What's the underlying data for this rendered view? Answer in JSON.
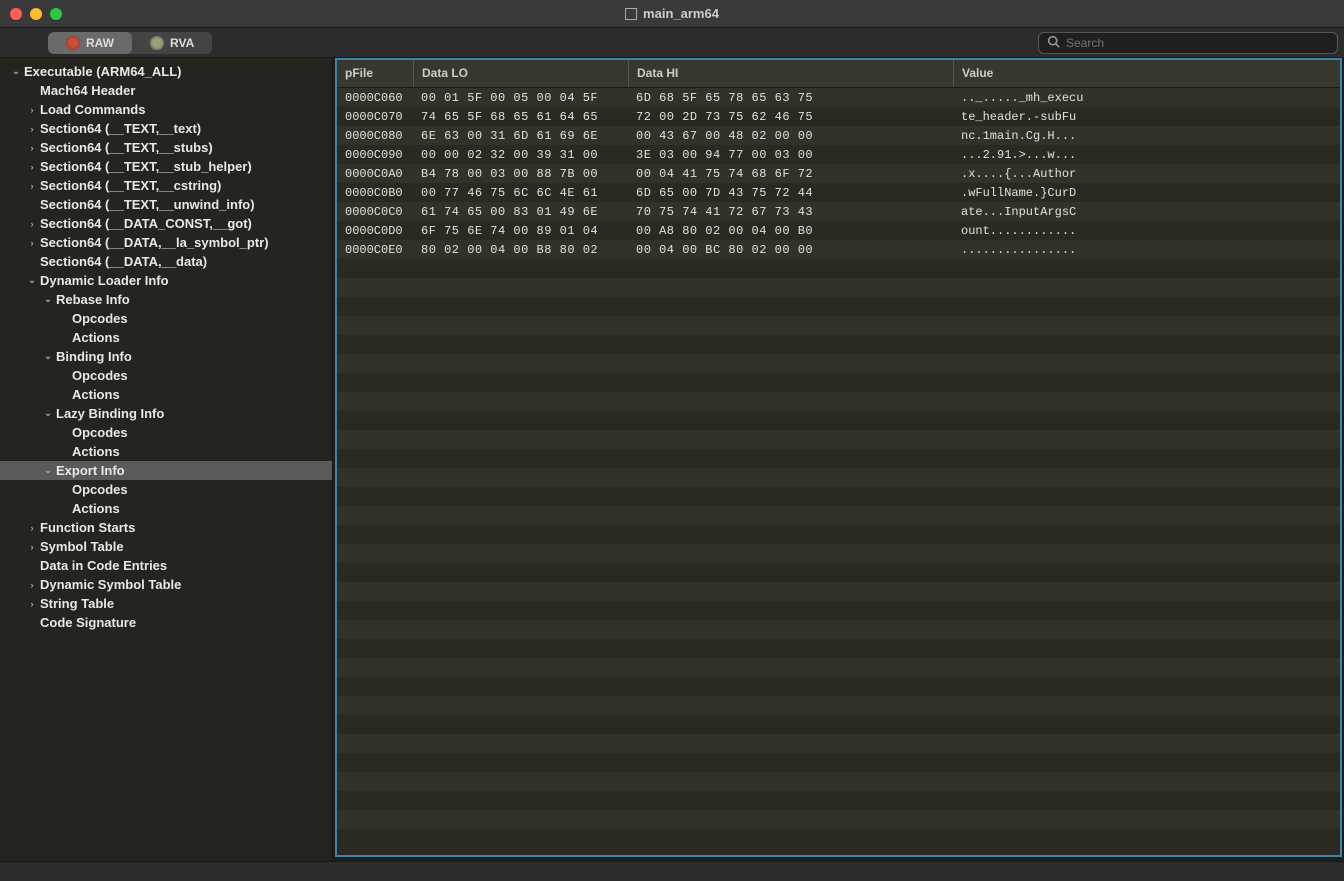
{
  "window": {
    "title": "main_arm64"
  },
  "toolbar": {
    "segments": [
      {
        "label": "RAW",
        "active": true
      },
      {
        "label": "RVA",
        "active": false
      }
    ],
    "search_placeholder": "Search"
  },
  "tree": [
    {
      "label": "Executable  (ARM64_ALL)",
      "depth": 0,
      "disclosure": "open"
    },
    {
      "label": "Mach64 Header",
      "depth": 1,
      "disclosure": "none"
    },
    {
      "label": "Load Commands",
      "depth": 1,
      "disclosure": "closed"
    },
    {
      "label": "Section64 (__TEXT,__text)",
      "depth": 1,
      "disclosure": "closed"
    },
    {
      "label": "Section64 (__TEXT,__stubs)",
      "depth": 1,
      "disclosure": "closed"
    },
    {
      "label": "Section64 (__TEXT,__stub_helper)",
      "depth": 1,
      "disclosure": "closed"
    },
    {
      "label": "Section64 (__TEXT,__cstring)",
      "depth": 1,
      "disclosure": "closed"
    },
    {
      "label": "Section64 (__TEXT,__unwind_info)",
      "depth": 1,
      "disclosure": "none"
    },
    {
      "label": "Section64 (__DATA_CONST,__got)",
      "depth": 1,
      "disclosure": "closed"
    },
    {
      "label": "Section64 (__DATA,__la_symbol_ptr)",
      "depth": 1,
      "disclosure": "closed"
    },
    {
      "label": "Section64 (__DATA,__data)",
      "depth": 1,
      "disclosure": "none"
    },
    {
      "label": "Dynamic Loader Info",
      "depth": 1,
      "disclosure": "open"
    },
    {
      "label": "Rebase Info",
      "depth": 2,
      "disclosure": "open"
    },
    {
      "label": "Opcodes",
      "depth": 3,
      "disclosure": "none"
    },
    {
      "label": "Actions",
      "depth": 3,
      "disclosure": "none"
    },
    {
      "label": "Binding Info",
      "depth": 2,
      "disclosure": "open"
    },
    {
      "label": "Opcodes",
      "depth": 3,
      "disclosure": "none"
    },
    {
      "label": "Actions",
      "depth": 3,
      "disclosure": "none"
    },
    {
      "label": "Lazy Binding Info",
      "depth": 2,
      "disclosure": "open"
    },
    {
      "label": "Opcodes",
      "depth": 3,
      "disclosure": "none"
    },
    {
      "label": "Actions",
      "depth": 3,
      "disclosure": "none"
    },
    {
      "label": "Export Info",
      "depth": 2,
      "disclosure": "open",
      "selected": true
    },
    {
      "label": "Opcodes",
      "depth": 3,
      "disclosure": "none"
    },
    {
      "label": "Actions",
      "depth": 3,
      "disclosure": "none"
    },
    {
      "label": "Function Starts",
      "depth": 1,
      "disclosure": "closed"
    },
    {
      "label": "Symbol Table",
      "depth": 1,
      "disclosure": "closed"
    },
    {
      "label": "Data in Code Entries",
      "depth": 1,
      "disclosure": "none"
    },
    {
      "label": "Dynamic Symbol Table",
      "depth": 1,
      "disclosure": "closed"
    },
    {
      "label": "String Table",
      "depth": 1,
      "disclosure": "closed"
    },
    {
      "label": "Code Signature",
      "depth": 1,
      "disclosure": "none"
    }
  ],
  "columns": {
    "pfile": "pFile",
    "data_lo": "Data LO",
    "data_hi": "Data HI",
    "value": "Value"
  },
  "rows": [
    {
      "pfile": "0000C060",
      "lo": "00 01 5F 00 05 00 04 5F",
      "hi": "6D 68 5F 65 78 65 63 75",
      "val": ".._....._mh_execu"
    },
    {
      "pfile": "0000C070",
      "lo": "74 65 5F 68 65 61 64 65",
      "hi": "72 00 2D 73 75 62 46 75",
      "val": "te_header.-subFu"
    },
    {
      "pfile": "0000C080",
      "lo": "6E 63 00 31 6D 61 69 6E",
      "hi": "00 43 67 00 48 02 00 00",
      "val": "nc.1main.Cg.H..."
    },
    {
      "pfile": "0000C090",
      "lo": "00 00 02 32 00 39 31 00",
      "hi": "3E 03 00 94 77 00 03 00",
      "val": "...2.91.>...w..."
    },
    {
      "pfile": "0000C0A0",
      "lo": "B4 78 00 03 00 88 7B 00",
      "hi": "00 04 41 75 74 68 6F 72",
      "val": ".x....{...Author"
    },
    {
      "pfile": "0000C0B0",
      "lo": "00 77 46 75 6C 6C 4E 61",
      "hi": "6D 65 00 7D 43 75 72 44",
      "val": ".wFullName.}CurD"
    },
    {
      "pfile": "0000C0C0",
      "lo": "61 74 65 00 83 01 49 6E",
      "hi": "70 75 74 41 72 67 73 43",
      "val": "ate...InputArgsC"
    },
    {
      "pfile": "0000C0D0",
      "lo": "6F 75 6E 74 00 89 01 04",
      "hi": "00 A8 80 02 00 04 00 B0",
      "val": "ount............"
    },
    {
      "pfile": "0000C0E0",
      "lo": "80 02 00 04 00 B8 80 02",
      "hi": "00 04 00 BC 80 02 00 00",
      "val": "................"
    }
  ],
  "empty_rows": 30
}
